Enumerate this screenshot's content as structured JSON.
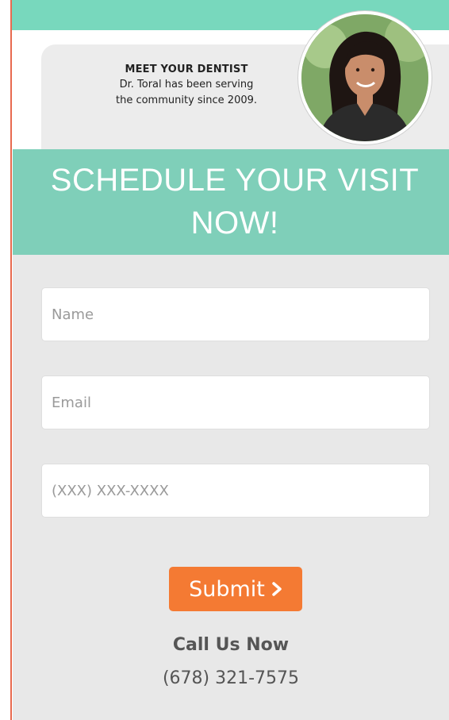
{
  "meet": {
    "title": "MEET YOUR DENTIST",
    "line1": "Dr. Toral has been serving",
    "line2": "the community since 2009."
  },
  "schedule": {
    "line1": "SCHEDULE YOUR VISIT",
    "line2": "NOW!"
  },
  "form": {
    "name_placeholder": "Name",
    "email_placeholder": "Email",
    "phone_placeholder": "(XXX) XXX-XXXX",
    "submit_label": "Submit"
  },
  "contact": {
    "label": "Call Us Now",
    "phone": "(678) 321-7575"
  },
  "colors": {
    "accent_green": "#78d8bd",
    "banner_green": "#7fcfb9",
    "submit_orange": "#f47a33",
    "panel_gray": "#e8e8e8"
  },
  "icons": {
    "submit_icon": "chevron-right-icon",
    "dentist_photo": "dentist-portrait"
  }
}
